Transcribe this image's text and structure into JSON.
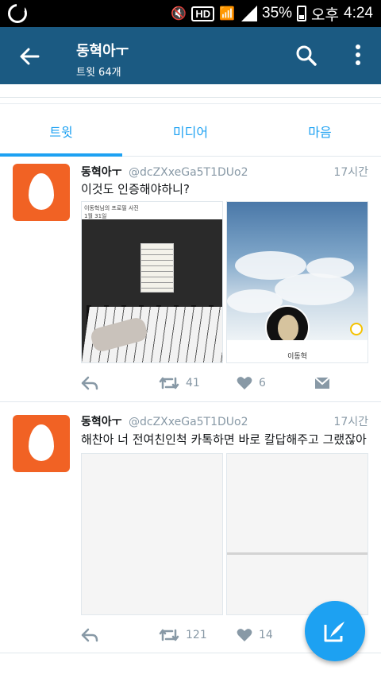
{
  "status": {
    "battery": "35%",
    "ampm": "오후",
    "time": "4:24",
    "hd": "HD"
  },
  "header": {
    "title": "동혁아ㅜ",
    "subtitle": "트윗 64개"
  },
  "tabs": [
    {
      "label": "트윗",
      "active": true
    },
    {
      "label": "미디어",
      "active": false
    },
    {
      "label": "마음",
      "active": false
    }
  ],
  "tweets": [
    {
      "name": "동혁아ㅜ",
      "handle": "@dcZXxeGa5T1DUo2",
      "time": "17시간",
      "text": "이것도 인증해야하니?",
      "media": {
        "left_caption": "이동혁님의 프로필 사진",
        "left_sub": "1월 31일",
        "right_caption": "이동혁"
      },
      "retweets": "41",
      "likes": "6"
    },
    {
      "name": "동혁아ㅜ",
      "handle": "@dcZXxeGa5T1DUo2",
      "time": "17시간",
      "text": "해찬아 너 전여친인척 카톡하면 바로 칼답해주고 그랬잖아",
      "retweets": "121",
      "likes": "14"
    }
  ],
  "colors": {
    "accent": "#1da1f2",
    "appbar": "#1b5a82",
    "avatar": "#f16224"
  }
}
